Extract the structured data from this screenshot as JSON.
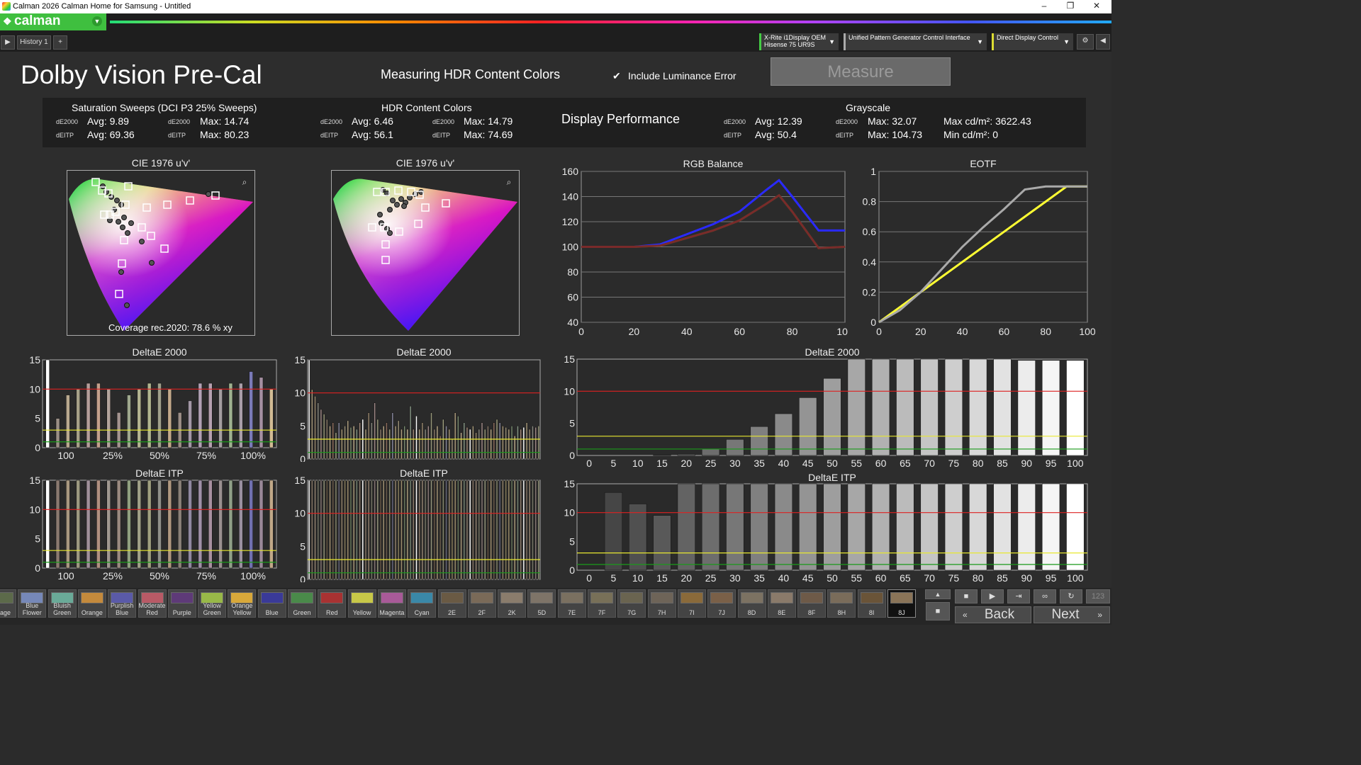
{
  "window": {
    "title": "Calman 2026 Calman Home for Samsung  - Untitled",
    "min": "–",
    "max": "❐",
    "close": "✕"
  },
  "app": {
    "logo": "calman"
  },
  "tabs": {
    "history": "History 1",
    "add": "+"
  },
  "devices": {
    "meter_line1": "X-Rite i1Display OEM",
    "meter_line2": "Hisense 75 UR9S",
    "generator": "Unified Pattern Generator Control Interface",
    "display": "Direct Display Control"
  },
  "page": {
    "title": "Dolby Vision Pre-Cal",
    "subtitle": "Measuring HDR Content Colors",
    "luminance_checkbox": "Include Luminance Error",
    "luminance_checked": true,
    "measure_button": "Measure"
  },
  "stats": {
    "sat": {
      "title": "Saturation Sweeps (DCI P3 25% Sweeps)",
      "l1": "dE2000",
      "avg1": "Avg: 9.89",
      "l2": "dE2000",
      "max1": "Max: 14.74",
      "l3": "dEITP",
      "avg2": "Avg: 69.36",
      "l4": "dEITP",
      "max2": "Max: 80.23"
    },
    "hdr": {
      "title": "HDR Content Colors",
      "l1": "dE2000",
      "avg1": "Avg: 6.46",
      "l2": "dE2000",
      "max1": "Max: 14.79",
      "l3": "dEITP",
      "avg2": "Avg: 56.1",
      "l4": "dEITP",
      "max2": "Max: 74.69"
    },
    "perf": "Display Performance",
    "gray": {
      "title": "Grayscale",
      "l1": "dE2000",
      "avg1": "Avg: 12.39",
      "l2": "dE2000",
      "max1": "Max: 32.07",
      "l3": "dEITP",
      "avg2": "Avg: 50.4",
      "l4": "dEITP",
      "max2": "Max: 104.73",
      "maxcd": "Max cd/m²:  3622.43",
      "mincd": "Min cd/m²:  0"
    }
  },
  "cie": {
    "left_title": "CIE 1976 u'v'",
    "right_title": "CIE 1976 u'v'",
    "coverage": "Coverage rec.2020:  78.6 % xy"
  },
  "charts": {
    "rgb": {
      "title": "RGB Balance",
      "xticks": [
        "0",
        "20",
        "40",
        "60",
        "80",
        "100"
      ],
      "yticks": [
        "40",
        "60",
        "80",
        "100",
        "120",
        "140",
        "160"
      ]
    },
    "eotf": {
      "title": "EOTF",
      "xticks": [
        "0",
        "20",
        "40",
        "60",
        "80",
        "100"
      ],
      "yticks": [
        "0",
        "0.2",
        "0.4",
        "0.6",
        "0.8",
        "1"
      ]
    },
    "sat_de": {
      "title": "DeltaE 2000",
      "yticks": [
        "0",
        "5",
        "10",
        "15"
      ],
      "xticks": [
        "100",
        "25%",
        "50%",
        "75%",
        "100%"
      ]
    },
    "sat_itp": {
      "title": "DeltaE ITP",
      "yticks": [
        "0",
        "5",
        "10",
        "15"
      ],
      "xticks": [
        "100",
        "25%",
        "50%",
        "75%",
        "100%"
      ]
    },
    "hdr_de": {
      "title": "DeltaE 2000",
      "yticks": [
        "0",
        "5",
        "10",
        "15"
      ]
    },
    "hdr_itp": {
      "title": "DeltaE ITP",
      "yticks": [
        "0",
        "5",
        "10",
        "15"
      ]
    },
    "gray_de": {
      "title": "DeltaE 2000",
      "yticks": [
        "0",
        "5",
        "10",
        "15"
      ],
      "xticks": [
        "0",
        "5",
        "10",
        "15",
        "20",
        "25",
        "30",
        "35",
        "40",
        "45",
        "50",
        "55",
        "60",
        "65",
        "70",
        "75",
        "80",
        "85",
        "90",
        "95",
        "100"
      ]
    },
    "gray_itp": {
      "title": "DeltaE ITP",
      "yticks": [
        "0",
        "5",
        "10",
        "15"
      ],
      "xticks": [
        "0",
        "5",
        "10",
        "15",
        "20",
        "25",
        "30",
        "35",
        "40",
        "45",
        "50",
        "55",
        "60",
        "65",
        "70",
        "75",
        "80",
        "85",
        "90",
        "95",
        "100"
      ]
    }
  },
  "chart_data": [
    {
      "type": "line",
      "title": "RGB Balance",
      "x": [
        0,
        10,
        20,
        30,
        40,
        50,
        60,
        70,
        75,
        80,
        90,
        100
      ],
      "ylim": [
        40,
        160
      ],
      "xlim": [
        0,
        100
      ],
      "series": [
        {
          "color": "#2a2aff",
          "values": [
            100,
            100,
            100,
            102,
            110,
            118,
            128,
            145,
            153,
            140,
            113,
            113
          ]
        },
        {
          "color": "#2e7d1e",
          "values": [
            100,
            100,
            100,
            101,
            107,
            113,
            121,
            134,
            141,
            128,
            99,
            100
          ]
        },
        {
          "color": "#7a2a2a",
          "values": [
            100,
            100,
            100,
            101,
            107,
            113,
            121,
            134,
            141,
            128,
            99,
            100
          ]
        }
      ]
    },
    {
      "type": "line",
      "title": "EOTF",
      "x": [
        0,
        10,
        20,
        30,
        40,
        50,
        60,
        70,
        80,
        90,
        100
      ],
      "ylim": [
        0,
        1
      ],
      "xlim": [
        0,
        100
      ],
      "series": [
        {
          "color": "#ffff33",
          "values": [
            0,
            0.1,
            0.2,
            0.3,
            0.4,
            0.5,
            0.6,
            0.7,
            0.8,
            0.9,
            0.9
          ]
        },
        {
          "color": "#aaaaaa",
          "values": [
            0,
            0.08,
            0.2,
            0.35,
            0.5,
            0.63,
            0.75,
            0.88,
            0.9,
            0.9,
            0.9
          ]
        }
      ]
    },
    {
      "type": "bar",
      "title": "DeltaE 2000",
      "ylim": [
        0,
        15
      ],
      "values": [
        15,
        5,
        9,
        10,
        11,
        11,
        10,
        6,
        9,
        10,
        11,
        11,
        10,
        6,
        8,
        11,
        11,
        10,
        11,
        11,
        13,
        12,
        10
      ],
      "colors": [
        "#ffffff",
        "#9b8f86",
        "#b9a98f",
        "#a6a088",
        "#b59e9a",
        "#c3a08c",
        "#b3a49c",
        "#a49490",
        "#9fa88e",
        "#b4b491",
        "#b1b690",
        "#a0a08c",
        "#c3a98b",
        "#9c8e86",
        "#a398a6",
        "#b1a0b4",
        "#b6a0b0",
        "#a49ea0",
        "#9fb290",
        "#a99ea9",
        "#7a7ab8",
        "#a58fa2",
        "#d1bb94"
      ]
    },
    {
      "type": "bar",
      "title": "DeltaE ITP",
      "ylim": [
        0,
        15
      ],
      "values": [
        15,
        15,
        15,
        15,
        15,
        15,
        15,
        15,
        15,
        15,
        15,
        15,
        15,
        15,
        15,
        15,
        15,
        15,
        15,
        15,
        15,
        15,
        15
      ]
    },
    {
      "type": "bar",
      "title": "DeltaE 2000",
      "ylim": [
        0,
        15
      ],
      "values": [
        15,
        10.5,
        9.5,
        8.5,
        7.5,
        6.8,
        6,
        5,
        5.5,
        4,
        5.5,
        4.5,
        5,
        5.8,
        4.8,
        5,
        4.5,
        5.5,
        6,
        4.5,
        7,
        5.5,
        8.5,
        6,
        4.5,
        5,
        5.5,
        4.5,
        7,
        5,
        5.8,
        4.5,
        5,
        4.5,
        8,
        4.5,
        6.5,
        4.5,
        5.5,
        4.5,
        5,
        7,
        4.5,
        5,
        3.5,
        6,
        5,
        4.5,
        3,
        7,
        6.5,
        4,
        5.5,
        4.8,
        4.5,
        5,
        4,
        4.5,
        5.5,
        4.5,
        5,
        4.5,
        5.5,
        6,
        5.5,
        5,
        4.8,
        4.5,
        5,
        3.5,
        5,
        4.5,
        4.8,
        5.5,
        4.5,
        5,
        4.8,
        5
      ]
    },
    {
      "type": "bar",
      "title": "DeltaE ITP",
      "ylim": [
        0,
        15
      ],
      "values": [
        15
      ]
    },
    {
      "type": "bar",
      "title": "DeltaE 2000",
      "ylim": [
        0,
        15
      ],
      "categories": [
        "0",
        "5",
        "10",
        "15",
        "20",
        "25",
        "30",
        "35",
        "40",
        "45",
        "50",
        "55",
        "60",
        "65",
        "70",
        "75",
        "80",
        "85",
        "90",
        "95",
        "100"
      ],
      "values": [
        0,
        0,
        0,
        0.1,
        0.2,
        1,
        2.5,
        4.5,
        6.5,
        9,
        12,
        15,
        15,
        15,
        15,
        15,
        15,
        15,
        14.8,
        14.8,
        14.8
      ]
    },
    {
      "type": "bar",
      "title": "DeltaE ITP",
      "ylim": [
        0,
        15
      ],
      "categories": [
        "0",
        "5",
        "10",
        "15",
        "20",
        "25",
        "30",
        "35",
        "40",
        "45",
        "50",
        "55",
        "60",
        "65",
        "70",
        "75",
        "80",
        "85",
        "90",
        "95",
        "100"
      ],
      "values": [
        0,
        13.5,
        11.5,
        9.5,
        15,
        15,
        15,
        15,
        15,
        15,
        15,
        15,
        15,
        15,
        15,
        15,
        15,
        15,
        15,
        15,
        15
      ]
    }
  ],
  "swatches": [
    {
      "label": "ollage",
      "color": "#5c6a4a"
    },
    {
      "label": "Blue Flower",
      "color": "#7688b8"
    },
    {
      "label": "Bluish Green",
      "color": "#6aaa98"
    },
    {
      "label": "Orange",
      "color": "#c48a3c"
    },
    {
      "label": "Purplish Blue",
      "color": "#5a5aa8"
    },
    {
      "label": "Moderate Red",
      "color": "#b85a66"
    },
    {
      "label": "Purple",
      "color": "#5e3a78"
    },
    {
      "label": "Yellow Green",
      "color": "#98b848"
    },
    {
      "label": "Orange Yellow",
      "color": "#d8a83a"
    },
    {
      "label": "Blue",
      "color": "#3a3a98"
    },
    {
      "label": "Green",
      "color": "#4a8a4a"
    },
    {
      "label": "Red",
      "color": "#a83232"
    },
    {
      "label": "Yellow",
      "color": "#c8c848"
    },
    {
      "label": "Magenta",
      "color": "#a85a98"
    },
    {
      "label": "Cyan",
      "color": "#3a88a8"
    },
    {
      "label": "2E",
      "color": "#6a5a44"
    },
    {
      "label": "2F",
      "color": "#7a6a58"
    },
    {
      "label": "2K",
      "color": "#8a7c6c"
    },
    {
      "label": "5D",
      "color": "#7e7468"
    },
    {
      "label": "7E",
      "color": "#7a7060"
    },
    {
      "label": "7F",
      "color": "#787058"
    },
    {
      "label": "7G",
      "color": "#6a6450"
    },
    {
      "label": "7H",
      "color": "#6e6458"
    },
    {
      "label": "7I",
      "color": "#8a6a3a"
    },
    {
      "label": "7J",
      "color": "#7a6048"
    },
    {
      "label": "8D",
      "color": "#7c7262"
    },
    {
      "label": "8E",
      "color": "#8a7a6a"
    },
    {
      "label": "8F",
      "color": "#6e5a48"
    },
    {
      "label": "8H",
      "color": "#7a6c5a"
    },
    {
      "label": "8I",
      "color": "#6a5438"
    },
    {
      "label": "8J",
      "color": "#8a7458"
    }
  ],
  "nav": {
    "back": "Back",
    "next": "Next",
    "page": "123"
  }
}
